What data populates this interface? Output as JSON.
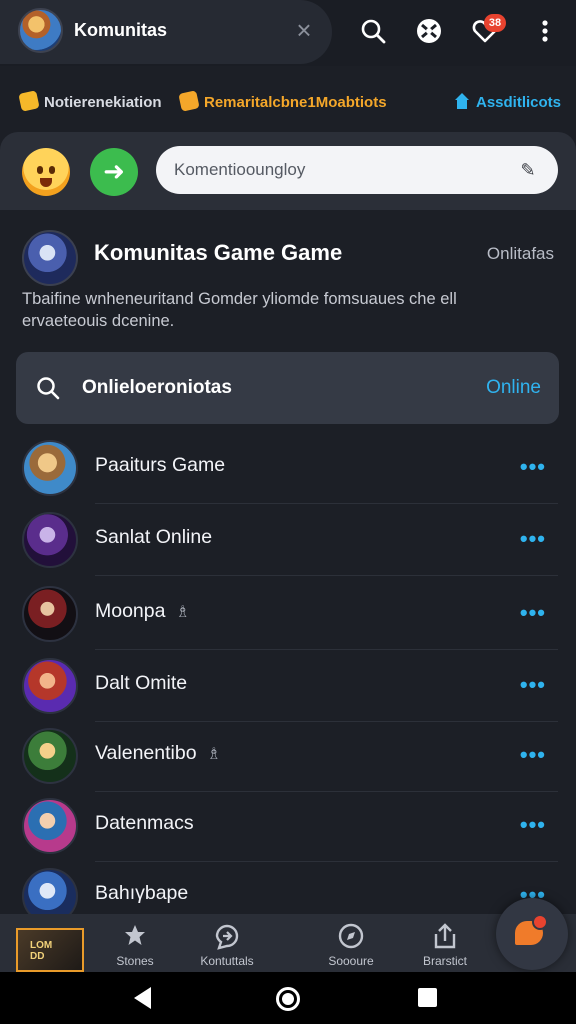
{
  "header": {
    "tab_title": "Komunitas",
    "notification_count": "38"
  },
  "quick_links": [
    {
      "label": "Notierenekiation",
      "color": "#d8dbe2"
    },
    {
      "label": "Remaritalcbne1Moabtiots",
      "color": "#f4a72a"
    },
    {
      "label": "Assditlicots",
      "color": "#2fb3ee"
    }
  ],
  "composer": {
    "search_placeholder": "Komentiooungloy"
  },
  "community": {
    "title": "Komunitas  Game Game",
    "status": "Onlitafas",
    "description": "Tbaifine wnheneuritand Gomder yliomde fomsuaues che ell ervaeteouis dcenine."
  },
  "member_search": {
    "label": "Onlieloeroniotas",
    "status": "Online"
  },
  "members": [
    {
      "name": "Paaiturs Game",
      "tag": ""
    },
    {
      "name": "Sanlat Online",
      "tag": ""
    },
    {
      "name": "Moonpa",
      "tag": "♗"
    },
    {
      "name": "Dalt Omite",
      "tag": ""
    },
    {
      "name": "Valenentibo",
      "tag": "♗"
    },
    {
      "name": "Datenmacs",
      "tag": ""
    },
    {
      "name": "Bahıγbape",
      "tag": ""
    }
  ],
  "more_glyph": "•••",
  "bottom_nav": {
    "thumb_label": "LOM\nDD",
    "items": [
      {
        "label": "Stones",
        "icon": "star-cog-icon"
      },
      {
        "label": "Kontuttals",
        "icon": "chat-refresh-icon"
      },
      {
        "label": "Soooure",
        "icon": "compass-icon"
      },
      {
        "label": "Brarstict",
        "icon": "share-icon"
      }
    ]
  },
  "colors": {
    "accent_blue": "#2fb3ee",
    "accent_orange": "#f4a72a",
    "green_button": "#3cbc4e",
    "badge_red": "#e8432f"
  }
}
